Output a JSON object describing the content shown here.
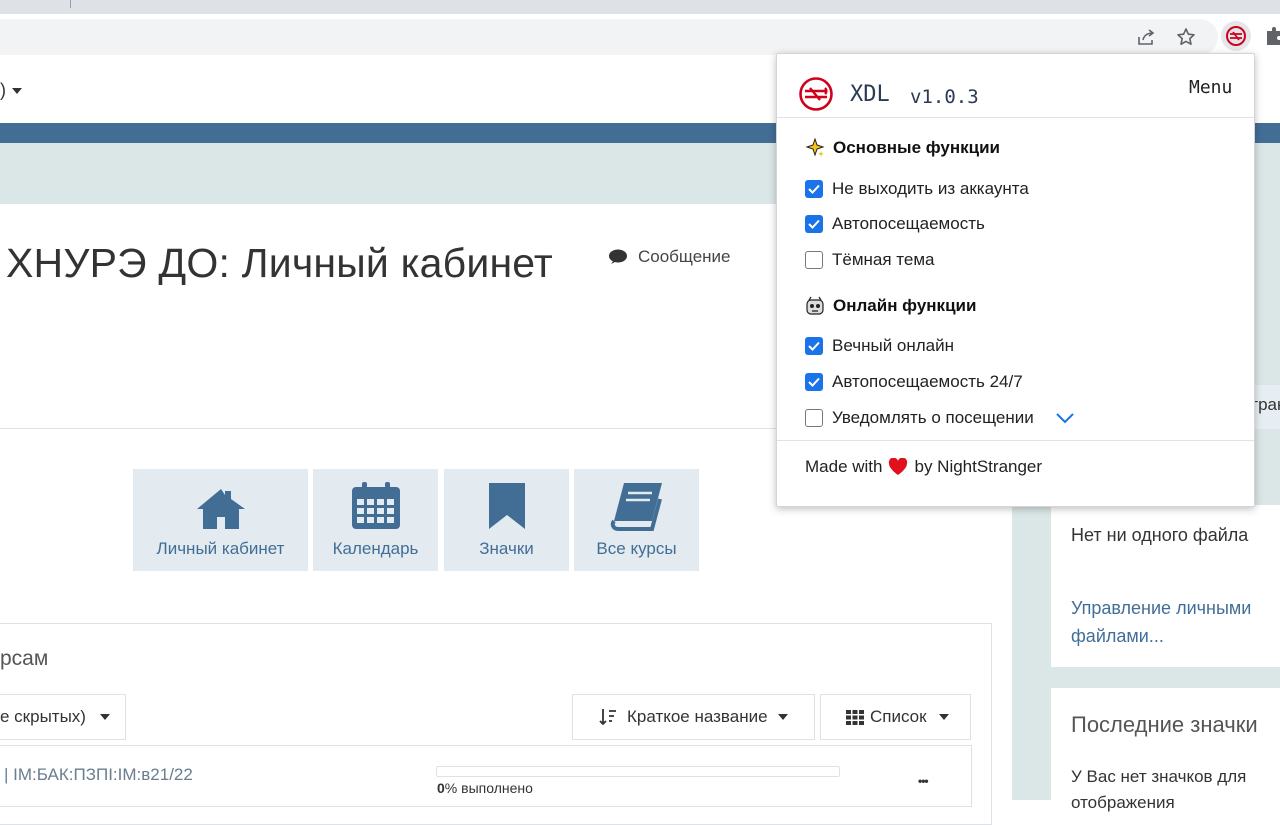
{
  "popup": {
    "app_name": "XDL",
    "version": "v1.0.3",
    "menu_label": "Menu",
    "section_basic": {
      "title": "Основные функции",
      "icon": "sparkles-icon"
    },
    "basic_options": [
      {
        "label": "Не выходить из аккаунта",
        "checked": true
      },
      {
        "label": "Автопосещаемость",
        "checked": true
      },
      {
        "label": "Тёмная тема",
        "checked": false
      }
    ],
    "section_online": {
      "title": "Онлайн функции",
      "icon": "robot-face-icon"
    },
    "online_options": [
      {
        "label": "Вечный онлайн",
        "checked": true
      },
      {
        "label": "Автопосещаемость 24/7",
        "checked": true
      },
      {
        "label": "Уведомлять о посещении",
        "checked": false
      }
    ],
    "footer": {
      "made_with": "Made with",
      "by": "by NightStranger"
    },
    "accent_color": "#1a73e8",
    "logo_color": "#d0021b"
  },
  "page": {
    "title": "ХНУРЭ ДО: Личный кабинет",
    "message_button": "Сообщение",
    "user_menu_partial": ")",
    "nav_tiles": [
      {
        "label": "Личный кабинет",
        "icon": "home-icon"
      },
      {
        "label": "Календарь",
        "icon": "calendar-icon"
      },
      {
        "label": "Значки",
        "icon": "bookmark-icon"
      },
      {
        "label": "Все курсы",
        "icon": "book-icon"
      }
    ],
    "courses": {
      "title_partial": "рсам",
      "filter_partial": "е скрытых)",
      "sort_label": "Краткое название",
      "view_label": "Список",
      "course_name_partial": "| ІМ:БАК:ПЗПІ:ІМ:в21/22",
      "progress_percent": 0,
      "progress_value": "0",
      "progress_suffix": "% выполнено",
      "more_label": "•••"
    }
  },
  "right_blocks": {
    "peek_text": "Страница",
    "files_empty": "Нет ни одного файла",
    "manage_files": "Управление личными файлами...",
    "badges_title": "Последние значки",
    "badges_empty": "У Вас нет значков для отображения"
  },
  "browser": {
    "icons": [
      "share-icon",
      "star-icon",
      "xdl-extension-icon",
      "puzzle-icon"
    ]
  }
}
